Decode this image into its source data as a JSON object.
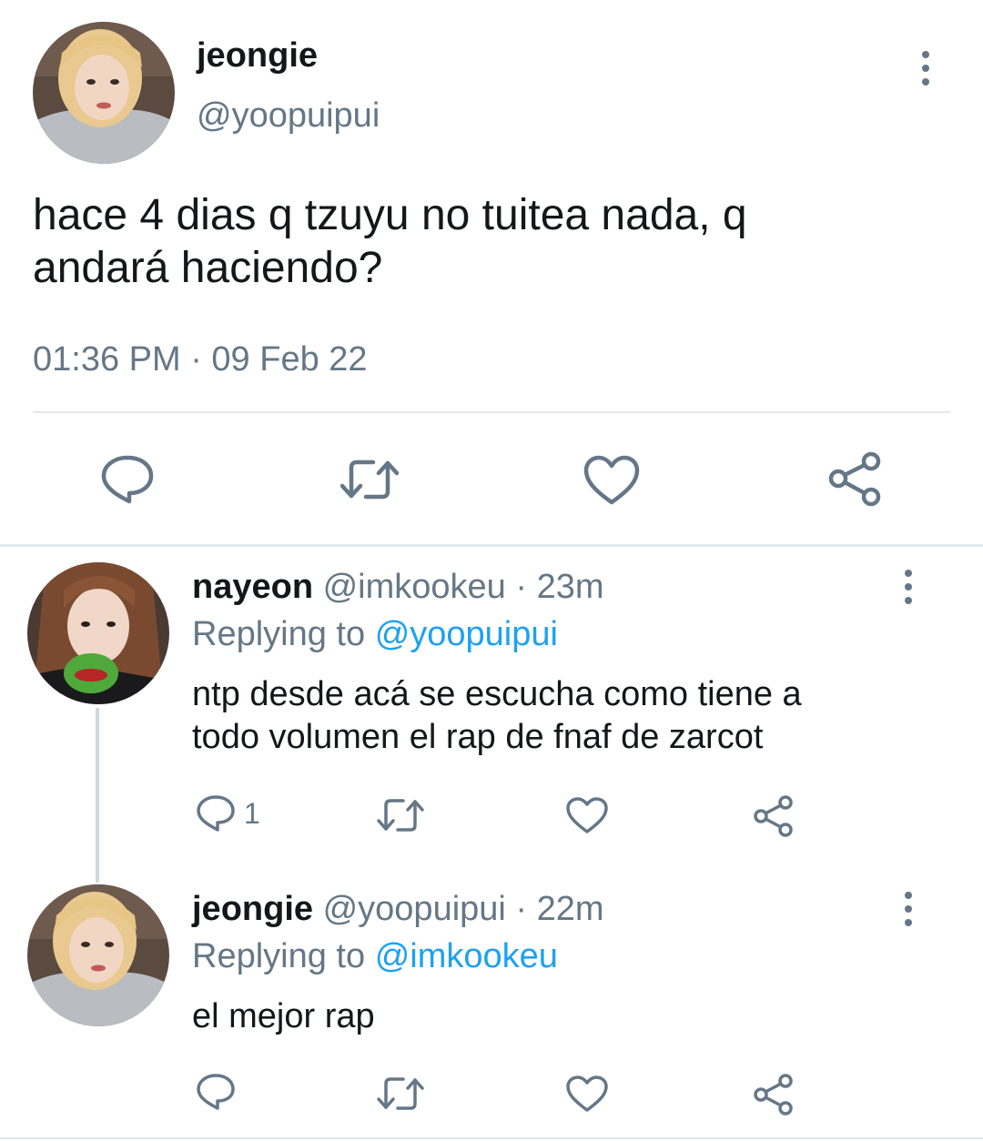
{
  "main_tweet": {
    "display_name": "jeongie",
    "handle": "@yoopuipui",
    "text_line1": "hace 4 dias q tzuyu no tuitea nada, q",
    "text_line2": "andará haciendo?",
    "timestamp": "01:36 PM · 09 Feb 22"
  },
  "replies": [
    {
      "display_name": "nayeon",
      "handle": "@imkookeu",
      "time": "· 23m",
      "replying_prefix": "Replying to",
      "replying_handle": "@yoopuipui",
      "text_line1": "ntp desde acá se escucha como tiene a",
      "text_line2": "todo volumen el rap de fnaf de zarcot",
      "reply_count": "1"
    },
    {
      "display_name": "jeongie",
      "handle": "@yoopuipui",
      "time": "· 22m",
      "replying_prefix": "Replying to",
      "replying_handle": "@imkookeu",
      "text_line1": "el mejor rap",
      "reply_count": ""
    }
  ],
  "icons": {
    "reply": "speech-bubble-icon",
    "retweet": "retweet-icon",
    "like": "heart-icon",
    "share": "share-icon",
    "more": "kebab-menu-icon"
  },
  "colors": {
    "text": "#14171a",
    "secondary": "#657786",
    "link": "#1da1f2",
    "divider": "#e1e8ed"
  }
}
